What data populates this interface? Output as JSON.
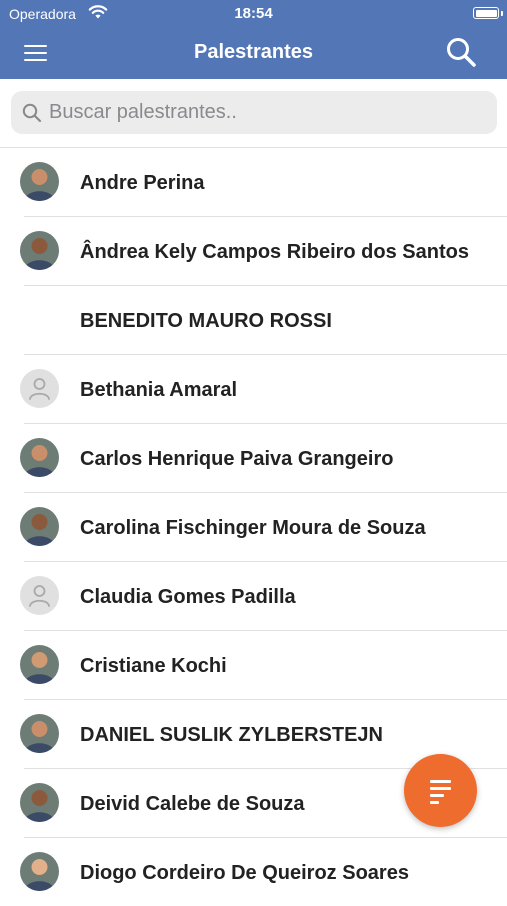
{
  "status_bar": {
    "carrier": "Operadora",
    "time": "18:54"
  },
  "header": {
    "title": "Palestrantes"
  },
  "search": {
    "placeholder": "Buscar palestrantes.."
  },
  "speakers": [
    {
      "name": "Andre Perina",
      "avatar": "photo"
    },
    {
      "name": "Ândrea Kely Campos Ribeiro dos Santos",
      "avatar": "photo"
    },
    {
      "name": "BENEDITO MAURO ROSSI",
      "avatar": "none"
    },
    {
      "name": "Bethania Amaral",
      "avatar": "placeholder"
    },
    {
      "name": "Carlos Henrique Paiva Grangeiro",
      "avatar": "photo"
    },
    {
      "name": "Carolina Fischinger Moura de Souza",
      "avatar": "photo"
    },
    {
      "name": "Claudia Gomes Padilla",
      "avatar": "placeholder"
    },
    {
      "name": "Cristiane Kochi",
      "avatar": "photo"
    },
    {
      "name": "DANIEL SUSLIK ZYLBERSTEJN",
      "avatar": "photo"
    },
    {
      "name": "Deivid Calebe de Souza",
      "avatar": "photo"
    },
    {
      "name": "Diogo Cordeiro De Queiroz Soares",
      "avatar": "photo"
    }
  ],
  "colors": {
    "header": "#5276b6",
    "fab": "#ee6c2d"
  },
  "icons": {
    "menu": "menu-icon",
    "search": "search-icon",
    "filter": "filter-icon"
  }
}
